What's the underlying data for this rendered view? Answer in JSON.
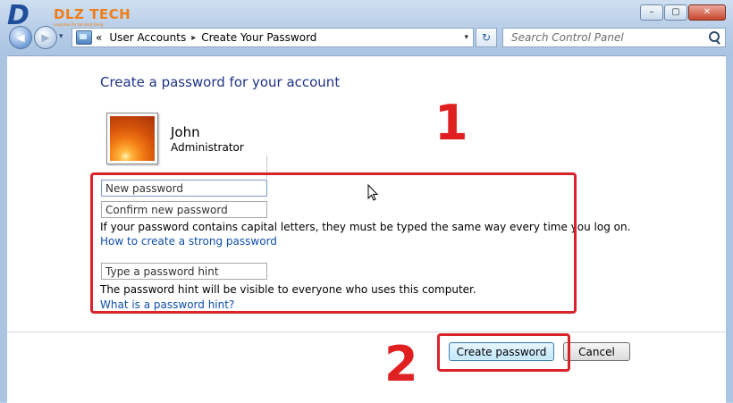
{
  "logo": {
    "mark": "D",
    "text": "DLZ TECH",
    "tagline": "Long Bao Ra Vat Hoat Dong"
  },
  "window": {
    "caption": {
      "minimize": "–",
      "maximize": "▢",
      "close": "✕"
    }
  },
  "nav": {
    "back_icon": "back-arrow-icon",
    "forward_icon": "forward-arrow-icon",
    "history": "▾",
    "address": {
      "prefix": "«",
      "crumbs": [
        "User Accounts",
        "Create Your Password"
      ],
      "separator": "▸",
      "dropdown": "▾"
    },
    "refresh": "↻",
    "search_placeholder": "Search Control Panel"
  },
  "content": {
    "title": "Create a password for your account",
    "user": {
      "name": "John",
      "role": "Administrator"
    },
    "fields": {
      "new_password_placeholder": "New password",
      "confirm_password_placeholder": "Confirm new password",
      "hint_placeholder": "Type a password hint"
    },
    "caps_notice": "If your password contains capital letters, they must be typed the same way every time you log on.",
    "strong_password_link": "How to create a strong password",
    "hint_notice": "The password hint will be visible to everyone who uses this computer.",
    "what_is_hint_link": "What is a password hint?",
    "buttons": {
      "create": "Create password",
      "cancel": "Cancel"
    }
  },
  "annotations": {
    "label_1": "1",
    "label_2": "2",
    "color": "#d8232a"
  }
}
